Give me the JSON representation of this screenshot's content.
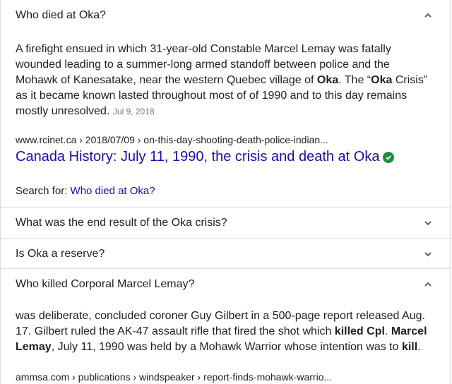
{
  "faq": [
    {
      "question": "Who died at Oka?",
      "expanded": true,
      "answer": {
        "t1": "A firefight ensued in which 31-year-old Constable Marcel Lemay was fatally wounded leading to a summer-long armed standoff between police and the Mohawk of Kanesatake, near the western Quebec village of ",
        "b1": "Oka",
        "t2": ". The “",
        "b2": "Oka",
        "t3": " Crisis” as it became known lasted throughout most of of 1990 and to this day remains mostly unresolved.",
        "date": "Jul 9, 2018"
      },
      "source_cite": "www.rcinet.ca › 2018/07/09 › on-this-day-shooting-death-police-indian...",
      "source_title": "Canada History: July 11, 1990, the crisis and death at Oka",
      "search_for_label": "Search for:",
      "search_for_link": "Who died at Oka?"
    },
    {
      "question": "What was the end result of the Oka crisis?",
      "expanded": false
    },
    {
      "question": "Is Oka a reserve?",
      "expanded": false
    },
    {
      "question": "Who killed Corporal Marcel Lemay?",
      "expanded": true,
      "answer": {
        "t1": "was deliberate, concluded coroner Guy Gilbert in a 500-page report released Aug. 17. Gilbert ruled the AK-47 assault rifle that fired the shot which ",
        "b1": "killed Cpl",
        "t2": ". ",
        "b2": "Marcel Lemay",
        "t3": ", July 11, 1990 was held by a Mohawk Warrior whose intention was to ",
        "b3": "kill",
        "t4": "."
      },
      "source_cite": "ammsa.com › publications › windspeaker › report-finds-mohawk-warrio..."
    }
  ],
  "icons": {
    "expanded": "chevron-up-icon",
    "collapsed": "chevron-down-icon",
    "verified": "verified-check-icon"
  },
  "colors": {
    "link": "#1a0dab",
    "text": "#202124",
    "muted": "#70757a",
    "verified": "#1e8e3e",
    "divider": "#dadce0"
  }
}
